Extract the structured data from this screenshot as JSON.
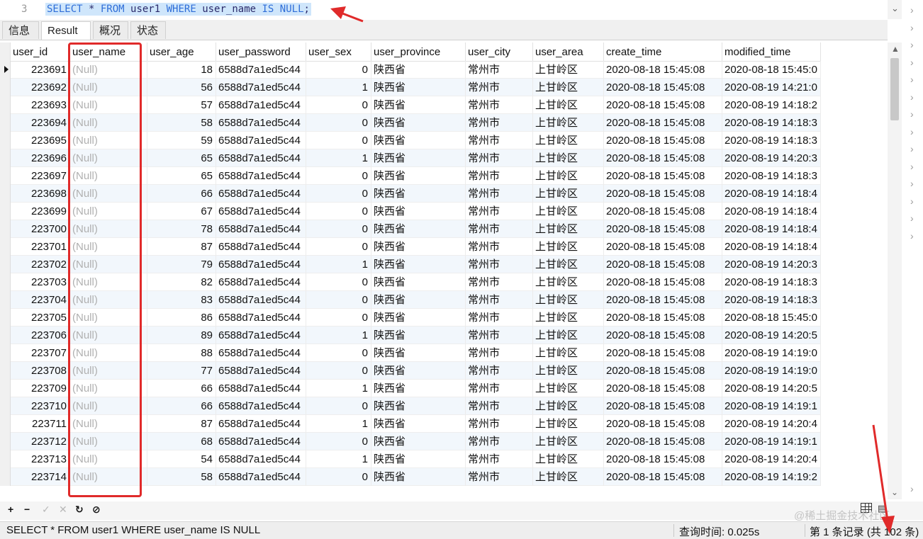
{
  "editor": {
    "line_number": "3",
    "sql_tokens": [
      {
        "t": "SELECT",
        "c": "kw"
      },
      {
        "t": " * ",
        "c": "id"
      },
      {
        "t": "FROM",
        "c": "kw"
      },
      {
        "t": " user1 ",
        "c": "id"
      },
      {
        "t": "WHERE",
        "c": "kw"
      },
      {
        "t": " user_name ",
        "c": "id"
      },
      {
        "t": "IS",
        "c": "kw"
      },
      {
        "t": " ",
        "c": "id"
      },
      {
        "t": "NULL",
        "c": "kw"
      },
      {
        "t": ";",
        "c": "id"
      }
    ]
  },
  "tabs": [
    {
      "label": "信息",
      "active": false
    },
    {
      "label": "Result 1",
      "active": true
    },
    {
      "label": "概况",
      "active": false
    },
    {
      "label": "状态",
      "active": false
    }
  ],
  "columns": [
    "user_id",
    "user_name",
    "user_age",
    "user_password",
    "user_sex",
    "user_province",
    "user_city",
    "user_area",
    "create_time",
    "modified_time"
  ],
  "null_label": "(Null)",
  "common": {
    "password": "6588d7a1ed5c44",
    "province": "陕西省",
    "city": "常州市",
    "area": "上甘岭区",
    "create_time": "2020-08-18 15:45:08"
  },
  "rows": [
    {
      "id": "223691",
      "age": "18",
      "sex": "0",
      "mod": "2020-08-18 15:45:0"
    },
    {
      "id": "223692",
      "age": "56",
      "sex": "1",
      "mod": "2020-08-19 14:21:0"
    },
    {
      "id": "223693",
      "age": "57",
      "sex": "0",
      "mod": "2020-08-19 14:18:2"
    },
    {
      "id": "223694",
      "age": "58",
      "sex": "0",
      "mod": "2020-08-19 14:18:3"
    },
    {
      "id": "223695",
      "age": "59",
      "sex": "0",
      "mod": "2020-08-19 14:18:3"
    },
    {
      "id": "223696",
      "age": "65",
      "sex": "1",
      "mod": "2020-08-19 14:20:3"
    },
    {
      "id": "223697",
      "age": "65",
      "sex": "0",
      "mod": "2020-08-19 14:18:3"
    },
    {
      "id": "223698",
      "age": "66",
      "sex": "0",
      "mod": "2020-08-19 14:18:4"
    },
    {
      "id": "223699",
      "age": "67",
      "sex": "0",
      "mod": "2020-08-19 14:18:4"
    },
    {
      "id": "223700",
      "age": "78",
      "sex": "0",
      "mod": "2020-08-19 14:18:4"
    },
    {
      "id": "223701",
      "age": "87",
      "sex": "0",
      "mod": "2020-08-19 14:18:4"
    },
    {
      "id": "223702",
      "age": "79",
      "sex": "1",
      "mod": "2020-08-19 14:20:3"
    },
    {
      "id": "223703",
      "age": "82",
      "sex": "0",
      "mod": "2020-08-19 14:18:3"
    },
    {
      "id": "223704",
      "age": "83",
      "sex": "0",
      "mod": "2020-08-19 14:18:3"
    },
    {
      "id": "223705",
      "age": "86",
      "sex": "0",
      "mod": "2020-08-18 15:45:0"
    },
    {
      "id": "223706",
      "age": "89",
      "sex": "1",
      "mod": "2020-08-19 14:20:5"
    },
    {
      "id": "223707",
      "age": "88",
      "sex": "0",
      "mod": "2020-08-19 14:19:0"
    },
    {
      "id": "223708",
      "age": "77",
      "sex": "0",
      "mod": "2020-08-19 14:19:0"
    },
    {
      "id": "223709",
      "age": "66",
      "sex": "1",
      "mod": "2020-08-19 14:20:5"
    },
    {
      "id": "223710",
      "age": "66",
      "sex": "0",
      "mod": "2020-08-19 14:19:1"
    },
    {
      "id": "223711",
      "age": "87",
      "sex": "1",
      "mod": "2020-08-19 14:20:4"
    },
    {
      "id": "223712",
      "age": "68",
      "sex": "0",
      "mod": "2020-08-19 14:19:1"
    },
    {
      "id": "223713",
      "age": "54",
      "sex": "1",
      "mod": "2020-08-19 14:20:4"
    },
    {
      "id": "223714",
      "age": "58",
      "sex": "0",
      "mod": "2020-08-19 14:19:2"
    }
  ],
  "toolbar": {
    "add": "+",
    "remove": "−",
    "apply": "✓",
    "discard": "✕",
    "refresh": "↻",
    "stop": "⊘"
  },
  "watermark": "@稀土掘金技术社区",
  "status": {
    "sql": "SELECT * FROM user1 WHERE user_name IS NULL",
    "query_time": "查询时间: 0.025s",
    "records": "第 1 条记录 (共 102 条)"
  },
  "colors": {
    "highlight": "#e02a2a",
    "keyword": "#2f6ed8",
    "selection": "#cfe6fb",
    "null_text": "#b0b0b0"
  },
  "icons": [
    "scroll-down-icon",
    "current-row-marker-icon",
    "grid-view-icon",
    "form-view-icon",
    "chevron-right-icon"
  ]
}
